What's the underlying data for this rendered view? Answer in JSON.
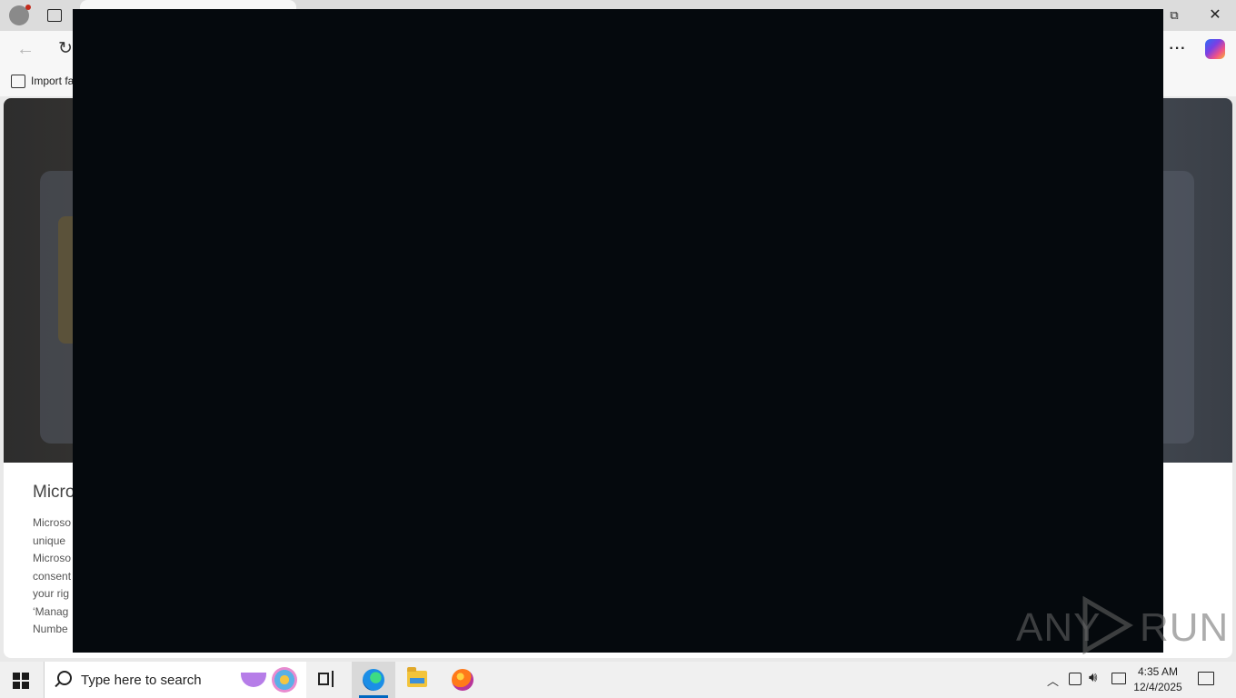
{
  "browser": {
    "favorites_bar": {
      "import_label": "Import fa"
    },
    "toolbar": {
      "more_label": "···"
    },
    "window_controls": {
      "restore": "⧉",
      "close": "✕"
    }
  },
  "page": {
    "article": {
      "title": "Micro",
      "body_lines": [
        "Microso",
        "unique",
        "Microso",
        "consent",
        "your rig",
        "‘Manag",
        "Numbe"
      ]
    }
  },
  "watermark": {
    "left": "ANY",
    "right": "RUN"
  },
  "taskbar": {
    "search_placeholder": "Type here to search",
    "clock": {
      "time": "4:35 AM",
      "date": "12/4/2025"
    }
  },
  "colors": {
    "overlay": "#05090d",
    "accent": "#0067c0"
  },
  "icons": [
    "profile-icon",
    "tab-actions-icon",
    "back-icon",
    "reload-icon",
    "more-icon",
    "copilot-icon",
    "import-favorites-icon",
    "windows-start-icon",
    "search-icon",
    "task-view-icon",
    "edge-icon",
    "file-explorer-icon",
    "firefox-icon",
    "tray-chevron-icon",
    "meet-now-icon",
    "volume-icon",
    "network-icon",
    "notifications-icon"
  ]
}
